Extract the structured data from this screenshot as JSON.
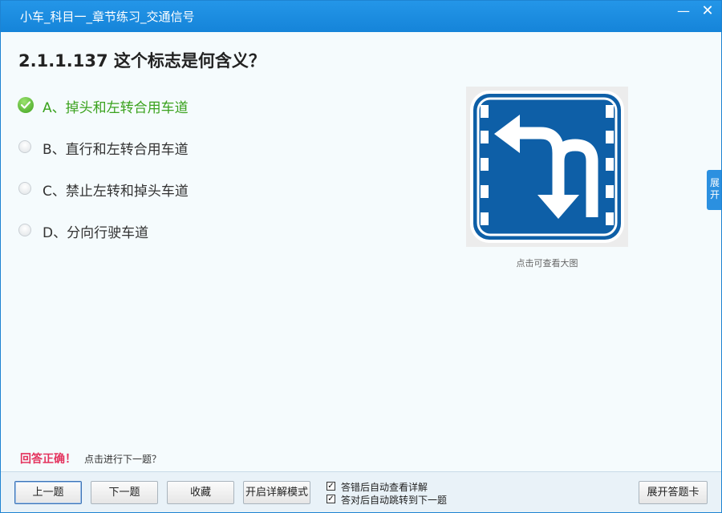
{
  "window": {
    "title": "小车_科目一_章节练习_交通信号",
    "minimize_glyph": "—",
    "close_glyph": "✕"
  },
  "question": {
    "text": "2.1.1.137 这个标志是何含义？"
  },
  "options": [
    {
      "label": "A、掉头和左转合用车道",
      "state": "correct"
    },
    {
      "label": "B、直行和左转合用车道",
      "state": "unselected"
    },
    {
      "label": "C、禁止左转和掉头车道",
      "state": "unselected"
    },
    {
      "label": "D、分向行驶车道",
      "state": "unselected"
    }
  ],
  "sign": {
    "caption": "点击可查看大图",
    "icon": "u-turn-and-left-turn-lane-sign",
    "color": "#0e5fa7"
  },
  "side_tab": {
    "label": "展开"
  },
  "feedback": {
    "result": "回答正确！",
    "hint": "点击进行下一题？"
  },
  "toolbar": {
    "prev_label": "上一题",
    "next_label": "下一题",
    "favorite_label": "收藏",
    "detail_mode_label": "开启详解模式",
    "answer_card_label": "展开答题卡"
  },
  "settings": {
    "auto_detail_label": "答错后自动查看详解",
    "auto_detail_checked": true,
    "auto_next_label": "答对后自动跳转到下一题",
    "auto_next_checked": true
  },
  "colors": {
    "title_bar": "#1e8be0",
    "correct": "#3aa21d",
    "result": "#e4335e",
    "accent": "#2b90e0"
  }
}
